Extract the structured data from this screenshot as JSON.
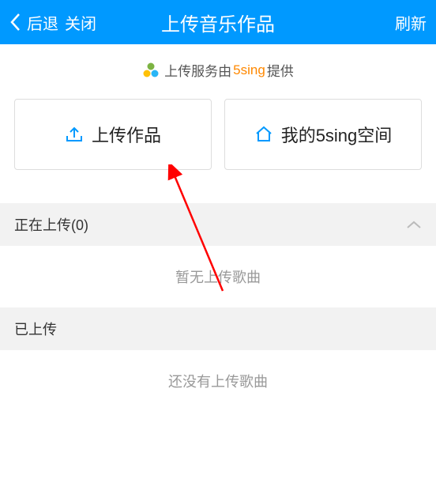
{
  "header": {
    "back": "后退",
    "close": "关闭",
    "title": "上传音乐作品",
    "refresh": "刷新"
  },
  "service": {
    "prefix": "上传服务由",
    "brand": "5sing",
    "suffix": "提供"
  },
  "buttons": {
    "upload": "上传作品",
    "myspace": "我的5sing空间"
  },
  "sections": {
    "uploading": {
      "label": "正在上传(0)",
      "empty": "暂无上传歌曲"
    },
    "uploaded": {
      "label": "已上传",
      "empty": "还没有上传歌曲"
    }
  }
}
